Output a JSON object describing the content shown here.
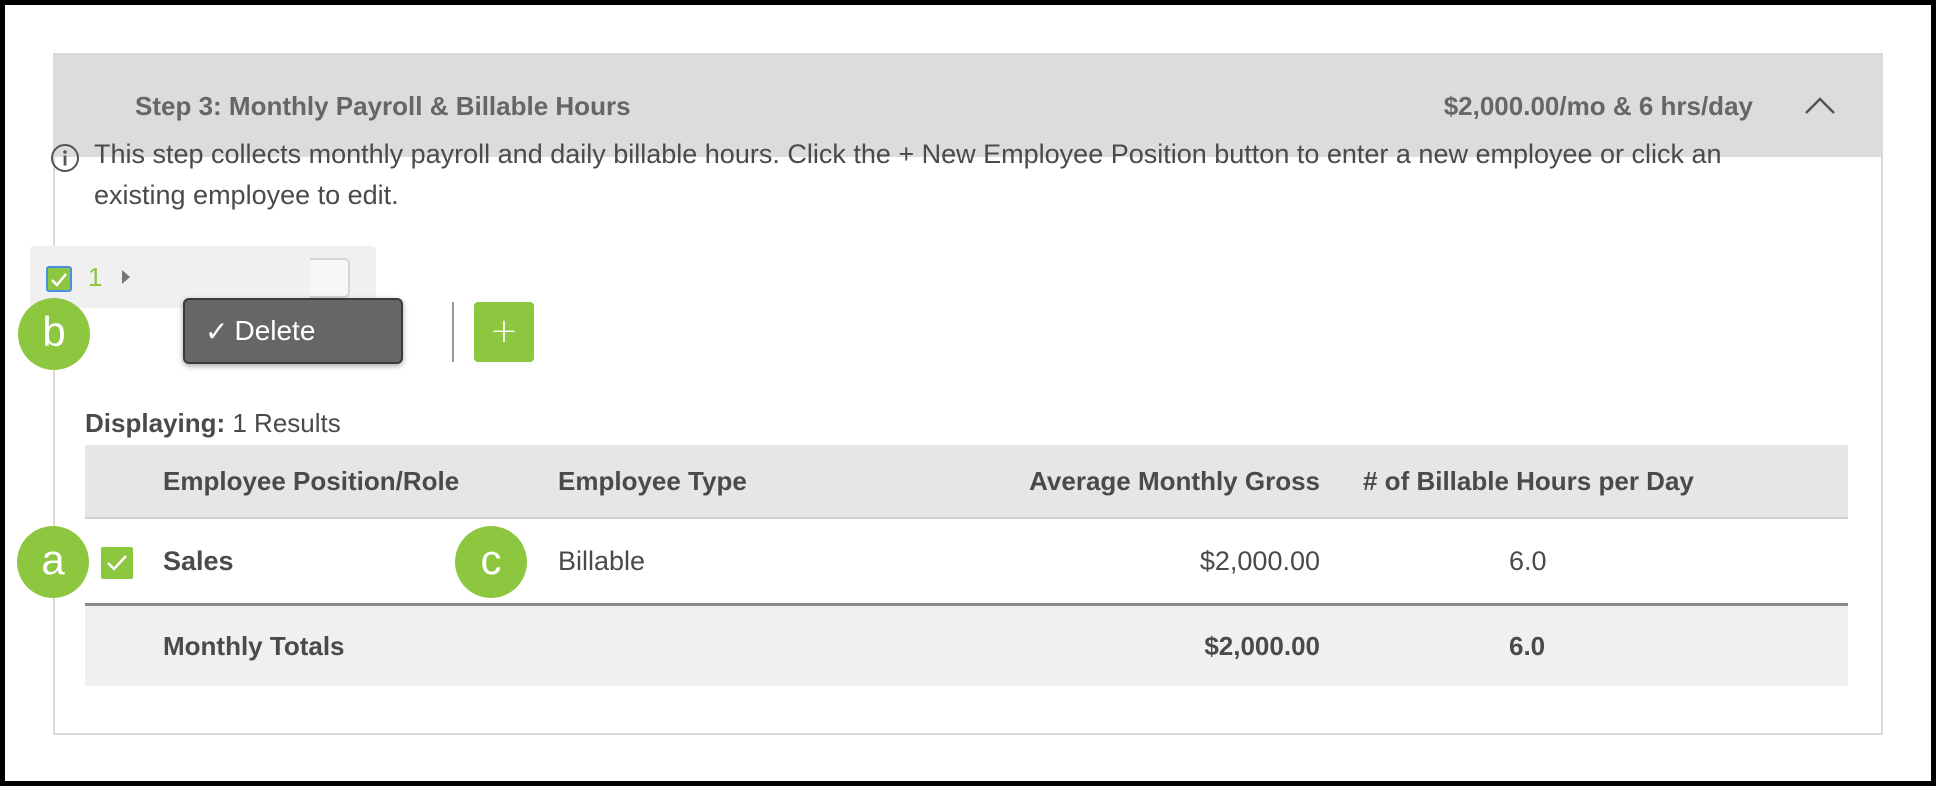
{
  "panel": {
    "step_title": "Step 3: Monthly Payroll & Billable Hours",
    "summary": "$2,000.00/mo & 6 hrs/day",
    "collapse_icon": "chevron-up-icon"
  },
  "info": {
    "icon": "info-icon",
    "text": "This step collects monthly payroll and daily billable hours. Click the + New Employee Position button to enter a new employee or click an existing employee to edit."
  },
  "toolbar": {
    "selected_count": "1",
    "menu_check": "✓",
    "menu_delete_label": "Delete",
    "add_label": "+"
  },
  "results": {
    "label": "Displaying:",
    "value": "1 Results"
  },
  "table": {
    "headers": {
      "role": "Employee Position/Role",
      "type": "Employee Type",
      "gross": "Average Monthly Gross",
      "hours": "# of Billable Hours per Day"
    },
    "rows": [
      {
        "role": "Sales",
        "type": "Billable",
        "gross": "$2,000.00",
        "hours": "6.0"
      }
    ],
    "totals": {
      "label": "Monthly Totals",
      "gross": "$2,000.00",
      "hours": "6.0"
    }
  },
  "callouts": {
    "a": "a",
    "b": "b",
    "c": "c"
  },
  "colors": {
    "accent": "#8dc63f",
    "header_bg": "#dcdcdc",
    "menu_bg": "#666666"
  }
}
